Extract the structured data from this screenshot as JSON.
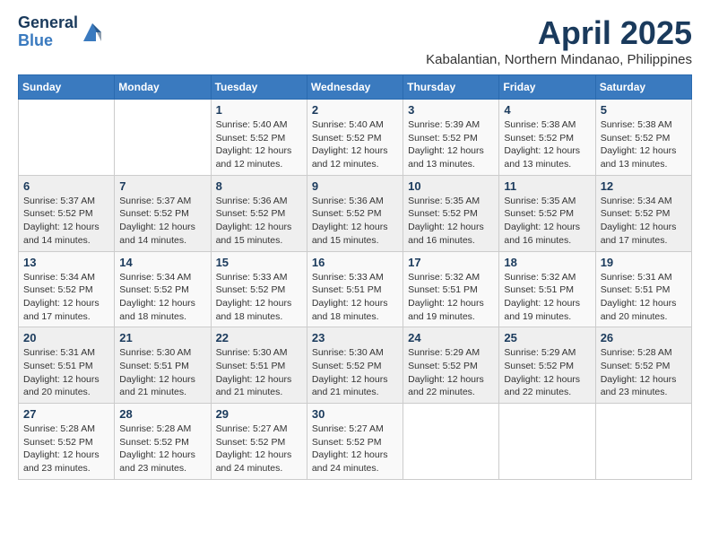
{
  "header": {
    "logo_general": "General",
    "logo_blue": "Blue",
    "title": "April 2025",
    "location": "Kabalantian, Northern Mindanao, Philippines"
  },
  "columns": [
    "Sunday",
    "Monday",
    "Tuesday",
    "Wednesday",
    "Thursday",
    "Friday",
    "Saturday"
  ],
  "weeks": [
    [
      {
        "day": "",
        "detail": ""
      },
      {
        "day": "",
        "detail": ""
      },
      {
        "day": "1",
        "detail": "Sunrise: 5:40 AM\nSunset: 5:52 PM\nDaylight: 12 hours\nand 12 minutes."
      },
      {
        "day": "2",
        "detail": "Sunrise: 5:40 AM\nSunset: 5:52 PM\nDaylight: 12 hours\nand 12 minutes."
      },
      {
        "day": "3",
        "detail": "Sunrise: 5:39 AM\nSunset: 5:52 PM\nDaylight: 12 hours\nand 13 minutes."
      },
      {
        "day": "4",
        "detail": "Sunrise: 5:38 AM\nSunset: 5:52 PM\nDaylight: 12 hours\nand 13 minutes."
      },
      {
        "day": "5",
        "detail": "Sunrise: 5:38 AM\nSunset: 5:52 PM\nDaylight: 12 hours\nand 13 minutes."
      }
    ],
    [
      {
        "day": "6",
        "detail": "Sunrise: 5:37 AM\nSunset: 5:52 PM\nDaylight: 12 hours\nand 14 minutes."
      },
      {
        "day": "7",
        "detail": "Sunrise: 5:37 AM\nSunset: 5:52 PM\nDaylight: 12 hours\nand 14 minutes."
      },
      {
        "day": "8",
        "detail": "Sunrise: 5:36 AM\nSunset: 5:52 PM\nDaylight: 12 hours\nand 15 minutes."
      },
      {
        "day": "9",
        "detail": "Sunrise: 5:36 AM\nSunset: 5:52 PM\nDaylight: 12 hours\nand 15 minutes."
      },
      {
        "day": "10",
        "detail": "Sunrise: 5:35 AM\nSunset: 5:52 PM\nDaylight: 12 hours\nand 16 minutes."
      },
      {
        "day": "11",
        "detail": "Sunrise: 5:35 AM\nSunset: 5:52 PM\nDaylight: 12 hours\nand 16 minutes."
      },
      {
        "day": "12",
        "detail": "Sunrise: 5:34 AM\nSunset: 5:52 PM\nDaylight: 12 hours\nand 17 minutes."
      }
    ],
    [
      {
        "day": "13",
        "detail": "Sunrise: 5:34 AM\nSunset: 5:52 PM\nDaylight: 12 hours\nand 17 minutes."
      },
      {
        "day": "14",
        "detail": "Sunrise: 5:34 AM\nSunset: 5:52 PM\nDaylight: 12 hours\nand 18 minutes."
      },
      {
        "day": "15",
        "detail": "Sunrise: 5:33 AM\nSunset: 5:52 PM\nDaylight: 12 hours\nand 18 minutes."
      },
      {
        "day": "16",
        "detail": "Sunrise: 5:33 AM\nSunset: 5:51 PM\nDaylight: 12 hours\nand 18 minutes."
      },
      {
        "day": "17",
        "detail": "Sunrise: 5:32 AM\nSunset: 5:51 PM\nDaylight: 12 hours\nand 19 minutes."
      },
      {
        "day": "18",
        "detail": "Sunrise: 5:32 AM\nSunset: 5:51 PM\nDaylight: 12 hours\nand 19 minutes."
      },
      {
        "day": "19",
        "detail": "Sunrise: 5:31 AM\nSunset: 5:51 PM\nDaylight: 12 hours\nand 20 minutes."
      }
    ],
    [
      {
        "day": "20",
        "detail": "Sunrise: 5:31 AM\nSunset: 5:51 PM\nDaylight: 12 hours\nand 20 minutes."
      },
      {
        "day": "21",
        "detail": "Sunrise: 5:30 AM\nSunset: 5:51 PM\nDaylight: 12 hours\nand 21 minutes."
      },
      {
        "day": "22",
        "detail": "Sunrise: 5:30 AM\nSunset: 5:51 PM\nDaylight: 12 hours\nand 21 minutes."
      },
      {
        "day": "23",
        "detail": "Sunrise: 5:30 AM\nSunset: 5:52 PM\nDaylight: 12 hours\nand 21 minutes."
      },
      {
        "day": "24",
        "detail": "Sunrise: 5:29 AM\nSunset: 5:52 PM\nDaylight: 12 hours\nand 22 minutes."
      },
      {
        "day": "25",
        "detail": "Sunrise: 5:29 AM\nSunset: 5:52 PM\nDaylight: 12 hours\nand 22 minutes."
      },
      {
        "day": "26",
        "detail": "Sunrise: 5:28 AM\nSunset: 5:52 PM\nDaylight: 12 hours\nand 23 minutes."
      }
    ],
    [
      {
        "day": "27",
        "detail": "Sunrise: 5:28 AM\nSunset: 5:52 PM\nDaylight: 12 hours\nand 23 minutes."
      },
      {
        "day": "28",
        "detail": "Sunrise: 5:28 AM\nSunset: 5:52 PM\nDaylight: 12 hours\nand 23 minutes."
      },
      {
        "day": "29",
        "detail": "Sunrise: 5:27 AM\nSunset: 5:52 PM\nDaylight: 12 hours\nand 24 minutes."
      },
      {
        "day": "30",
        "detail": "Sunrise: 5:27 AM\nSunset: 5:52 PM\nDaylight: 12 hours\nand 24 minutes."
      },
      {
        "day": "",
        "detail": ""
      },
      {
        "day": "",
        "detail": ""
      },
      {
        "day": "",
        "detail": ""
      }
    ]
  ]
}
